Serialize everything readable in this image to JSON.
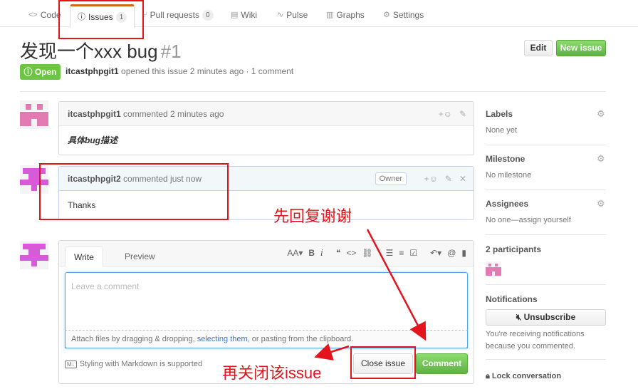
{
  "tabs": {
    "code": "Code",
    "issues": "Issues",
    "issues_count": "1",
    "pulls": "Pull requests",
    "pulls_count": "0",
    "wiki": "Wiki",
    "pulse": "Pulse",
    "graphs": "Graphs",
    "settings": "Settings"
  },
  "issue": {
    "title": "发现一个xxx bug",
    "number": "#1",
    "state": "Open",
    "author": "itcastphpgit1",
    "meta": "opened this issue 2 minutes ago · 1 comment",
    "edit_label": "Edit",
    "new_issue_label": "New issue"
  },
  "comments": [
    {
      "author": "itcastphpgit1",
      "action": "commented 2 minutes ago",
      "body": "具体bug描述"
    },
    {
      "author": "itcastphpgit2",
      "action": "commented just now",
      "badge": "Owner",
      "body": "Thanks"
    }
  ],
  "composer": {
    "write_tab": "Write",
    "preview_tab": "Preview",
    "placeholder": "Leave a comment",
    "attach_prefix": "Attach files by dragging & dropping, ",
    "attach_link": "selecting them",
    "attach_suffix": ", or pasting from the clipboard.",
    "markdown_note": "Styling with Markdown is supported",
    "close_label": "Close issue",
    "comment_label": "Comment"
  },
  "sidebar": {
    "labels_h": "Labels",
    "labels_v": "None yet",
    "milestone_h": "Milestone",
    "milestone_v": "No milestone",
    "assignees_h": "Assignees",
    "assignees_v": "No one—assign yourself",
    "participants": "2 participants",
    "notifications_h": "Notifications",
    "unsubscribe": "Unsubscribe",
    "notif_text1": "You're receiving notifications",
    "notif_text2": "because you commented.",
    "lock": "Lock conversation"
  },
  "annotations": {
    "reply_first": "先回复谢谢",
    "then_close": "再关闭该issue"
  },
  "colors": {
    "annotation_red": "#e3141c",
    "open_green": "#6cc644",
    "accent_orange": "#d26911",
    "avatar_pink": "#e27bb2",
    "avatar_magenta": "#d85ad8"
  }
}
